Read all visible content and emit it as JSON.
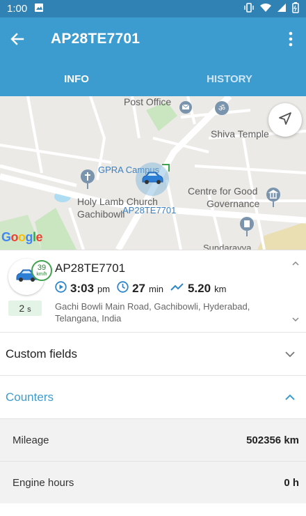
{
  "status_bar": {
    "time": "1:00"
  },
  "header": {
    "title": "AP28TE7701"
  },
  "tabs": [
    {
      "label": "INFO"
    },
    {
      "label": "HISTORY"
    }
  ],
  "map": {
    "labels": {
      "post_office": "Post Office",
      "shiva_temple": "Shiva Temple",
      "gpra_campus": "GPRA Campus",
      "holy_lamb": "Holy Lamb Church",
      "gachibowli": "Gachibowli",
      "centre_line1": "Centre for Good",
      "centre_line2": "Governance",
      "vehicle_plate": "AP28TE7701",
      "sundarayya": "Sundarayya"
    },
    "google_logo": [
      "G",
      "o",
      "o",
      "g",
      "l",
      "e"
    ]
  },
  "vehicle": {
    "name": "AP28TE7701",
    "speed": "39",
    "speed_unit": "km/h",
    "duration_value": "2",
    "duration_unit": "s",
    "time_value": "3:03",
    "time_unit": "pm",
    "minutes_value": "27",
    "minutes_unit": "min",
    "distance_value": "5.20",
    "distance_unit": "km",
    "address": "Gachi Bowli Main Road, Gachibowli, Hyderabad, Telangana, India"
  },
  "sections": {
    "custom_fields": "Custom fields",
    "counters": "Counters"
  },
  "counters": [
    {
      "key": "Mileage",
      "value": "502356 km"
    },
    {
      "key": "Engine hours",
      "value": "0 h"
    }
  ],
  "colors": {
    "primary": "#3d9ccf",
    "status_bar": "#2f82b3",
    "speed_green": "#3fa34d"
  }
}
